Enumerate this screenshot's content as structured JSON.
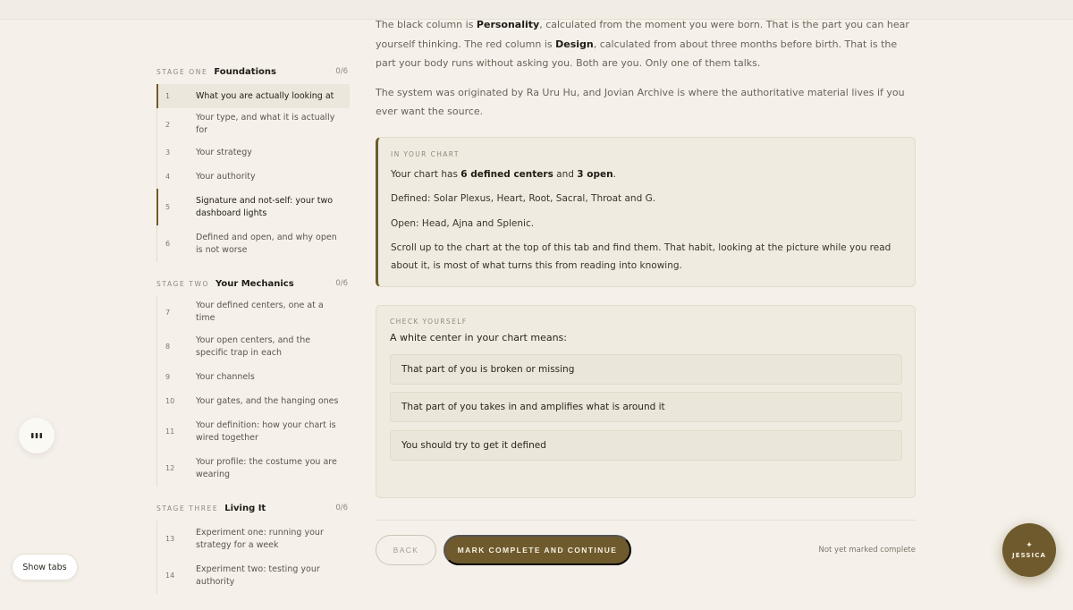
{
  "content": {
    "para1_a": "The black column is ",
    "para1_b": "Personality",
    "para1_c": ", calculated from the moment you were born. That is the part you can hear yourself thinking. The red column is ",
    "para1_d": "Design",
    "para1_e": ", calculated from about three months before birth. That is the part your body runs without asking you. Both are you. Only one of them talks.",
    "para2": "The system was originated by Ra Uru Hu, and Jovian Archive is where the authoritative material lives if you ever want the source."
  },
  "chart_card": {
    "kicker": "IN YOUR CHART",
    "summary_a": "Your chart has ",
    "summary_b": "6 defined centers",
    "summary_c": " and ",
    "summary_d": "3 open",
    "summary_e": ".",
    "defined": "Defined: Solar Plexus, Heart, Root, Sacral, Throat and G.",
    "open": "Open: Head, Ajna and Splenic.",
    "tip": "Scroll up to the chart at the top of this tab and find them. That habit, looking at the picture while you read about it, is most of what turns this from reading into knowing."
  },
  "quiz": {
    "kicker": "CHECK YOURSELF",
    "question": "A white center in your chart means:",
    "options": [
      "That part of you is broken or missing",
      "That part of you takes in and amplifies what is around it",
      "You should try to get it defined"
    ]
  },
  "actions": {
    "back": "BACK",
    "complete": "MARK COMPLETE AND CONTINUE",
    "status": "Not yet marked complete"
  },
  "sidebar": {
    "stages": [
      {
        "kicker": "STAGE ONE",
        "title": "Foundations",
        "count": "0/6",
        "lessons": [
          {
            "num": "1",
            "title": "What you are actually looking at"
          },
          {
            "num": "2",
            "title": "Your type, and what it is actually for"
          },
          {
            "num": "3",
            "title": "Your strategy"
          },
          {
            "num": "4",
            "title": "Your authority"
          },
          {
            "num": "5",
            "title": "Signature and not-self: your two dashboard lights"
          },
          {
            "num": "6",
            "title": "Defined and open, and why open is not worse"
          }
        ]
      },
      {
        "kicker": "STAGE TWO",
        "title": "Your Mechanics",
        "count": "0/6",
        "lessons": [
          {
            "num": "7",
            "title": "Your defined centers, one at a time"
          },
          {
            "num": "8",
            "title": "Your open centers, and the specific trap in each"
          },
          {
            "num": "9",
            "title": "Your channels"
          },
          {
            "num": "10",
            "title": "Your gates, and the hanging ones"
          },
          {
            "num": "11",
            "title": "Your definition: how your chart is wired together"
          },
          {
            "num": "12",
            "title": "Your profile: the costume you are wearing"
          }
        ]
      },
      {
        "kicker": "STAGE THREE",
        "title": "Living It",
        "count": "0/6",
        "lessons": [
          {
            "num": "13",
            "title": "Experiment one: running your strategy for a week"
          },
          {
            "num": "14",
            "title": "Experiment two: testing your authority"
          }
        ]
      }
    ]
  },
  "floating": {
    "show_tabs": "Show tabs",
    "assistant_icon": "✦",
    "assistant_name": "JESSICA"
  },
  "colors": {
    "accent": "#6e5a2c",
    "background": "#f5f1ea",
    "card": "#f0ebe1"
  }
}
